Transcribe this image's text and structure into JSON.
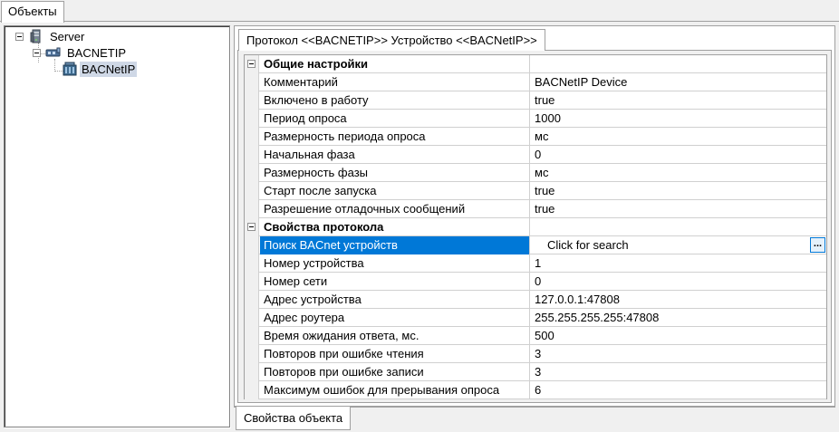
{
  "top_tab": {
    "label": "Объекты"
  },
  "tree": {
    "root": {
      "label": "Server",
      "icon": "server-icon"
    },
    "child": {
      "label": "BACNETIP",
      "icon": "network-protocol-icon"
    },
    "leaf": {
      "label": "BACNetIP",
      "icon": "device-icon"
    }
  },
  "inner_tab": {
    "label": "Протокол <<BACNETIP>> Устройство <<BACNetIP>>"
  },
  "properties": {
    "general": {
      "title": "Общие настройки",
      "rows": [
        {
          "name": "Комментарий",
          "value": "BACNetIP Device"
        },
        {
          "name": "Включено в работу",
          "value": "true"
        },
        {
          "name": "Период опроса",
          "value": "1000"
        },
        {
          "name": "Размерность периода опроса",
          "value": "мс"
        },
        {
          "name": "Начальная фаза",
          "value": "0"
        },
        {
          "name": "Размерность фазы",
          "value": "мс"
        },
        {
          "name": "Старт после запуска",
          "value": "true"
        },
        {
          "name": "Разрешение отладочных сообщений",
          "value": "true"
        }
      ]
    },
    "protocol": {
      "title": "Свойства протокола",
      "search_row": {
        "name": "Поиск BACnet устройств",
        "value": "Click for search",
        "button": "..."
      },
      "rows": [
        {
          "name": "Номер устройства",
          "value": "1"
        },
        {
          "name": "Номер сети",
          "value": "0"
        },
        {
          "name": "Адрес устройства",
          "value": "127.0.0.1:47808"
        },
        {
          "name": "Адрес роутера",
          "value": "255.255.255.255:47808"
        },
        {
          "name": "Время ожидания ответа, мс.",
          "value": "500"
        },
        {
          "name": "Повторов при ошибке чтения",
          "value": "3"
        },
        {
          "name": "Повторов при ошибке записи",
          "value": "3"
        },
        {
          "name": "Максимум ошибок для прерывания опроса",
          "value": "6"
        }
      ]
    }
  },
  "bottom_tab": {
    "label": "Свойства объекта"
  },
  "colors": {
    "selection": "#0078d7",
    "grid_line": "#d0d0d0",
    "tree_selection": "#cfd8e6"
  }
}
